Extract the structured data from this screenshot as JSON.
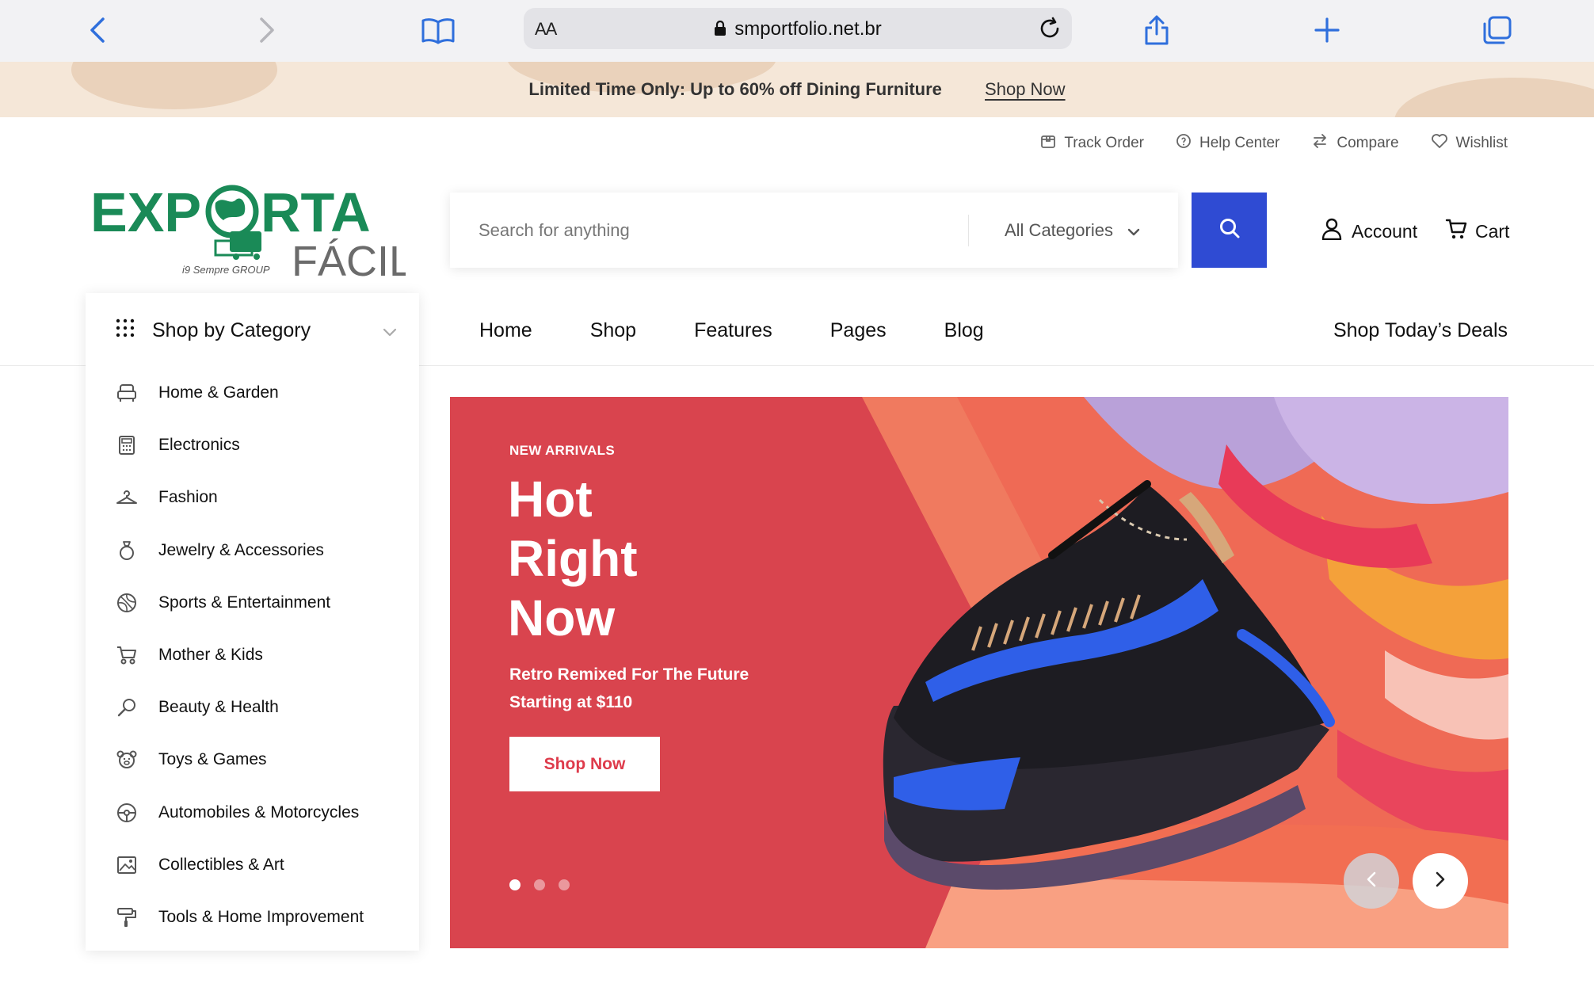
{
  "browser": {
    "reader_label": "AA",
    "url": "smportfolio.net.br"
  },
  "promo": {
    "text": "Limited Time Only: Up to 60% off Dining Furniture",
    "link": "Shop Now"
  },
  "top_links": [
    {
      "label": "Track Order",
      "icon": "box-icon"
    },
    {
      "label": "Help Center",
      "icon": "help-circle-icon"
    },
    {
      "label": "Compare",
      "icon": "compare-arrows-icon"
    },
    {
      "label": "Wishlist",
      "icon": "heart-icon"
    }
  ],
  "logo": {
    "word_top_left": "EXP",
    "word_top_right": "RTA",
    "word_bottom": "FÁCIL",
    "tagline": "i9 Sempre GROUP"
  },
  "search": {
    "placeholder": "Search for anything",
    "category": "All Categories"
  },
  "account_label": "Account",
  "cart_label": "Cart",
  "nav": {
    "items": [
      "Home",
      "Shop",
      "Features",
      "Pages",
      "Blog"
    ],
    "deals": "Shop Today’s Deals"
  },
  "sidebar": {
    "title": "Shop by Category",
    "items": [
      {
        "label": "Home & Garden",
        "icon": "armchair-icon"
      },
      {
        "label": "Electronics",
        "icon": "calculator-icon"
      },
      {
        "label": "Fashion",
        "icon": "hanger-icon"
      },
      {
        "label": "Jewelry & Accessories",
        "icon": "ring-icon"
      },
      {
        "label": "Sports & Entertainment",
        "icon": "ball-icon"
      },
      {
        "label": "Mother & Kids",
        "icon": "stroller-icon"
      },
      {
        "label": "Beauty & Health",
        "icon": "mirror-icon"
      },
      {
        "label": "Toys & Games",
        "icon": "teddy-bear-icon"
      },
      {
        "label": "Automobiles & Motorcycles",
        "icon": "steering-wheel-icon"
      },
      {
        "label": "Collectibles & Art",
        "icon": "picture-icon"
      },
      {
        "label": "Tools & Home Improvement",
        "icon": "paint-roller-icon"
      }
    ]
  },
  "hero": {
    "kicker": "NEW ARRIVALS",
    "title_lines": [
      "Hot",
      "Right",
      "Now"
    ],
    "subtitle_lines": [
      "Retro Remixed For The Future",
      "Starting at $110"
    ],
    "button": "Shop Now",
    "slide_count": 3,
    "active_slide": 1
  },
  "colors": {
    "accent_blue": "#2f4bd3",
    "hero_red": "#de4b53",
    "logo_green": "#1a8a57",
    "promo_bg": "#f5e7d8"
  }
}
